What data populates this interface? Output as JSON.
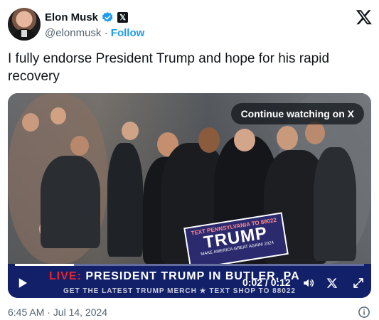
{
  "author": {
    "name": "Elon Musk",
    "handle": "@elonmusk",
    "separator": "·",
    "follow_label": "Follow",
    "verified_icon": "verified-badge-icon",
    "affiliate_icon": "x-affiliate-badge-icon"
  },
  "tweet": {
    "text": "I fully endorse President Trump and hope for his rapid recovery"
  },
  "media": {
    "continue_label": "Continue watching on X",
    "sign": {
      "top": "TEXT PENNSYLVANIA TO 88022",
      "main": "TRUMP",
      "sub": "MAKE AMERICA GREAT AGAIN! 2024"
    },
    "banner": {
      "live": "LIVE:",
      "headline": "PRESIDENT TRUMP IN BUTLER, PA",
      "ticker": "GET THE LATEST TRUMP MERCH ★ TEXT SHOP TO 88022"
    },
    "time_display": "0:02 / 0:12",
    "progress_fraction": 0.17
  },
  "footer": {
    "timestamp": "6:45 AM · Jul 14, 2024",
    "info_icon": "info-icon"
  },
  "colors": {
    "accent": "#1d9bf0",
    "text": "#0f1419",
    "secondary": "#536471",
    "banner": "#12206a"
  }
}
